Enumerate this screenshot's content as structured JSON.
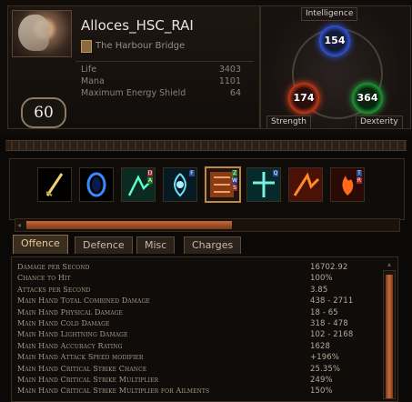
{
  "character": {
    "name": "Alloces_HSC_RAI",
    "location": "The Harbour Bridge",
    "level": "60",
    "stats": [
      {
        "label": "Life",
        "value": "3403"
      },
      {
        "label": "Mana",
        "value": "1101"
      },
      {
        "label": "Maximum Energy Shield",
        "value": "64"
      }
    ]
  },
  "attributes": {
    "intelligence": {
      "label": "Intelligence",
      "value": "154"
    },
    "strength": {
      "label": "Strength",
      "value": "174"
    },
    "dexterity": {
      "label": "Dexterity",
      "value": "364"
    }
  },
  "skills": [
    {
      "icon": "sword-skill-icon"
    },
    {
      "icon": "blue-ring-skill-icon"
    },
    {
      "icon": "green-archer-skill-icon",
      "badges": [
        "D",
        "A"
      ]
    },
    {
      "icon": "ice-spiral-skill-icon",
      "badges": [
        "F"
      ]
    },
    {
      "icon": "orange-totem-skill-icon",
      "badges": [
        "Z",
        "W",
        "S"
      ],
      "selected": true
    },
    {
      "icon": "teal-cross-skill-icon",
      "badges": [
        "Q"
      ]
    },
    {
      "icon": "fire-strike-skill-icon"
    },
    {
      "icon": "flame-figure-skill-icon",
      "badges": [
        "T",
        "R"
      ]
    }
  ],
  "tabs": [
    "Offence",
    "Defence",
    "Misc",
    "Charges"
  ],
  "active_tab": "Offence",
  "offence_stats": [
    {
      "label": "Damage per Second",
      "value": "16702.92"
    },
    {
      "label": "Chance to Hit",
      "value": "100%"
    },
    {
      "label": "Attacks per Second",
      "value": "3.85"
    },
    {
      "label": "Main Hand Total Combined Damage",
      "value": "438 - 2711"
    },
    {
      "label": "Main Hand Physical Damage",
      "value": "18 - 65"
    },
    {
      "label": "Main Hand Cold Damage",
      "value": "318 - 478"
    },
    {
      "label": "Main Hand Lightning Damage",
      "value": "102 - 2168"
    },
    {
      "label": "Main Hand Accuracy Rating",
      "value": "1628"
    },
    {
      "label": "Main Hand Attack Speed modifier",
      "value": "+196%"
    },
    {
      "label": "Main Hand Critical Strike Chance",
      "value": "25.35%"
    },
    {
      "label": "Main Hand Critical Strike Multiplier",
      "value": "249%"
    },
    {
      "label": "Main Hand Critical Strike Multiplier for Ailments",
      "value": "150%"
    }
  ],
  "colors": {
    "accent": "#c46a38",
    "int": "#3a62ff",
    "str": "#ff4a1a",
    "dex": "#2ac048"
  }
}
